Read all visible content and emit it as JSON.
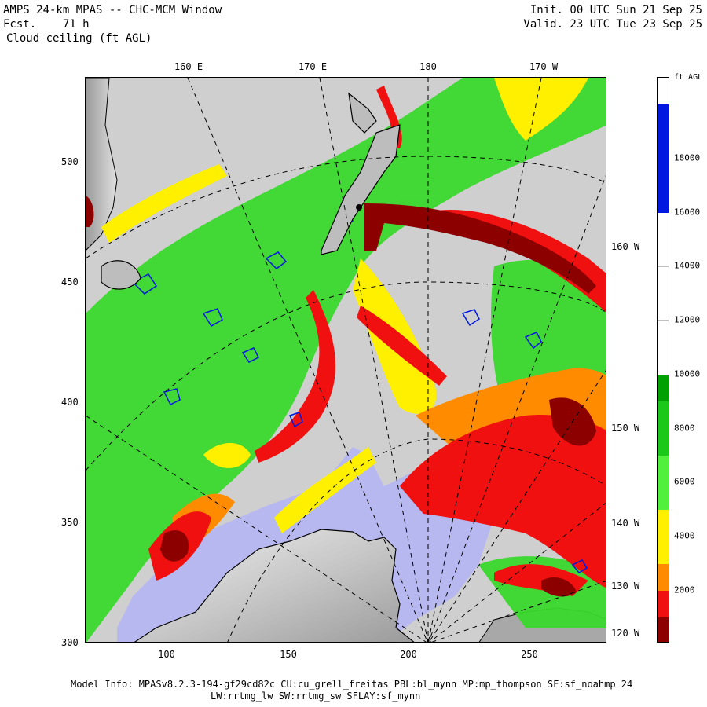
{
  "header": {
    "title": "AMPS 24-km MPAS -- CHC-MCM Window",
    "fcst_label": "Fcst.",
    "fcst_hours": "71 h",
    "field": "Cloud ceiling (ft AGL)",
    "init": "Init. 00 UTC Sun 21 Sep 25",
    "valid": "Valid. 23 UTC Tue 23 Sep 25"
  },
  "axes": {
    "y_ticks": [
      "500",
      "450",
      "400",
      "350",
      "300"
    ],
    "x_ticks": [
      "100",
      "150",
      "200",
      "250"
    ],
    "lon_top": [
      "160 E",
      "170 E",
      "180",
      "170 W"
    ],
    "lon_right": [
      "160 W",
      "150 W",
      "140 W",
      "130 W",
      "120 W"
    ]
  },
  "colorbar": {
    "unit": "ft AGL",
    "labels": [
      "18000",
      "16000",
      "14000",
      "12000",
      "10000",
      "8000",
      "6000",
      "4000",
      "2000"
    ],
    "colors": {
      "none": "#ffffff",
      "blue": "#0018e0",
      "green_dark": "#00a000",
      "green_mid": "#1ac81a",
      "green_light": "#50f03c",
      "yellow": "#fff000",
      "orange": "#ff8c00",
      "red": "#f01010",
      "dark_red": "#8c0000"
    }
  },
  "map_colors": {
    "background": "#cfcfcf",
    "ice_shelf": "#b8b8f0",
    "continent": "#d8d8d8"
  },
  "footer": {
    "line1": "Model Info: MPASv8.2.3-194-gf29cd82c CU:cu_grell_freitas PBL:bl_mynn MP:mp_thompson SF:sf_noahmp 24",
    "line2": "LW:rrtmg_lw SW:rrtmg_sw SFLAY:sf_mynn"
  }
}
